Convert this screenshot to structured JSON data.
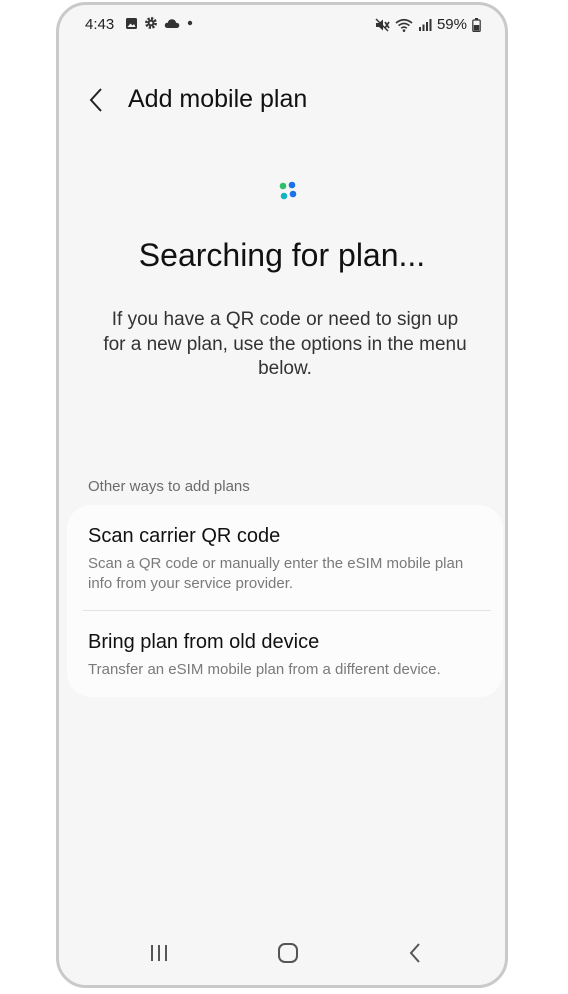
{
  "status_bar": {
    "time": "4:43",
    "battery": "59%",
    "left_icons": [
      "gallery-icon",
      "gear-icon",
      "cloud-icon",
      "dot-icon"
    ],
    "right_icons": [
      "mute-icon",
      "wifi-icon",
      "signal-icon",
      "battery-icon"
    ]
  },
  "header": {
    "title": "Add mobile plan"
  },
  "main": {
    "searching_title": "Searching for plan...",
    "description": "If you have a QR code or need to sign up for a new plan, use the options in the menu below.",
    "section_label": "Other ways to add plans",
    "options": [
      {
        "title": "Scan carrier QR code",
        "subtitle": "Scan a QR code or manually enter the eSIM mobile plan info from your service provider."
      },
      {
        "title": "Bring plan from old device",
        "subtitle": "Transfer an eSIM mobile plan from a different device."
      }
    ]
  },
  "colors": {
    "spinner_green": "#2bbf6e",
    "spinner_blue": "#1a73e8",
    "spinner_teal": "#14b3c2"
  },
  "nav_bar": {
    "buttons": [
      "recents-icon",
      "home-icon",
      "back-icon"
    ]
  }
}
